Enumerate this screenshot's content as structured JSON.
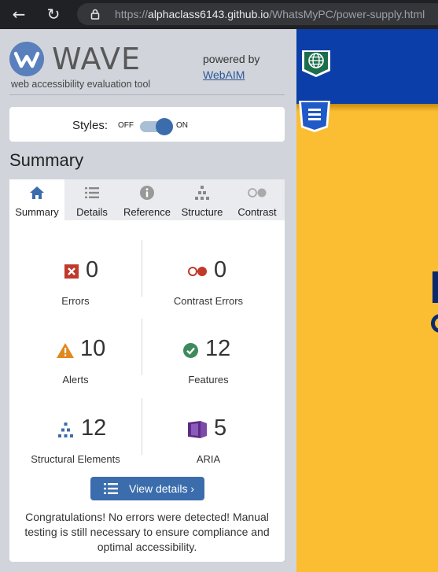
{
  "browser": {
    "url_prefix": "https://",
    "url_host": "alphaclass6143.github.io",
    "url_path": "/WhatsMyPC/power-supply.html",
    "icons": [
      "back-arrow-icon",
      "reload-icon",
      "lock-icon"
    ]
  },
  "wave": {
    "title": "WAVE",
    "tagline": "web accessibility evaluation tool",
    "powered_by": "powered by",
    "webaim": "WebAIM"
  },
  "styles_toggle": {
    "label": "Styles:",
    "off": "OFF",
    "on": "ON",
    "state": "on"
  },
  "summary_heading": "Summary",
  "tabs": [
    {
      "label": "Summary",
      "icon": "home-icon",
      "active": true
    },
    {
      "label": "Details",
      "icon": "list-icon",
      "active": false
    },
    {
      "label": "Reference",
      "icon": "info-icon",
      "active": false
    },
    {
      "label": "Structure",
      "icon": "hierarchy-icon",
      "active": false
    },
    {
      "label": "Contrast",
      "icon": "contrast-icon",
      "active": false
    }
  ],
  "stats": {
    "errors": {
      "value": "0",
      "label": "Errors",
      "color": "#c0392b"
    },
    "contrast_errors": {
      "value": "0",
      "label": "Contrast Errors",
      "color": "#c0392b"
    },
    "alerts": {
      "value": "10",
      "label": "Alerts",
      "color": "#e0891c"
    },
    "features": {
      "value": "12",
      "label": "Features",
      "color": "#3e8a5c"
    },
    "structural": {
      "value": "12",
      "label": "Structural Elements",
      "color": "#3b6dad"
    },
    "aria": {
      "value": "5",
      "label": "ARIA",
      "color": "#5b2c83"
    }
  },
  "view_details": "View details ›",
  "congrats": "Congratulations! No errors were detected! Manual testing is still necessary to ensure compliance and optimal accessibility.",
  "colors": {
    "sidebar_bg": "#d1d5db",
    "accent": "#3b6dad",
    "page_yellow": "#fbbe32",
    "page_blue": "#0b3ea8"
  }
}
